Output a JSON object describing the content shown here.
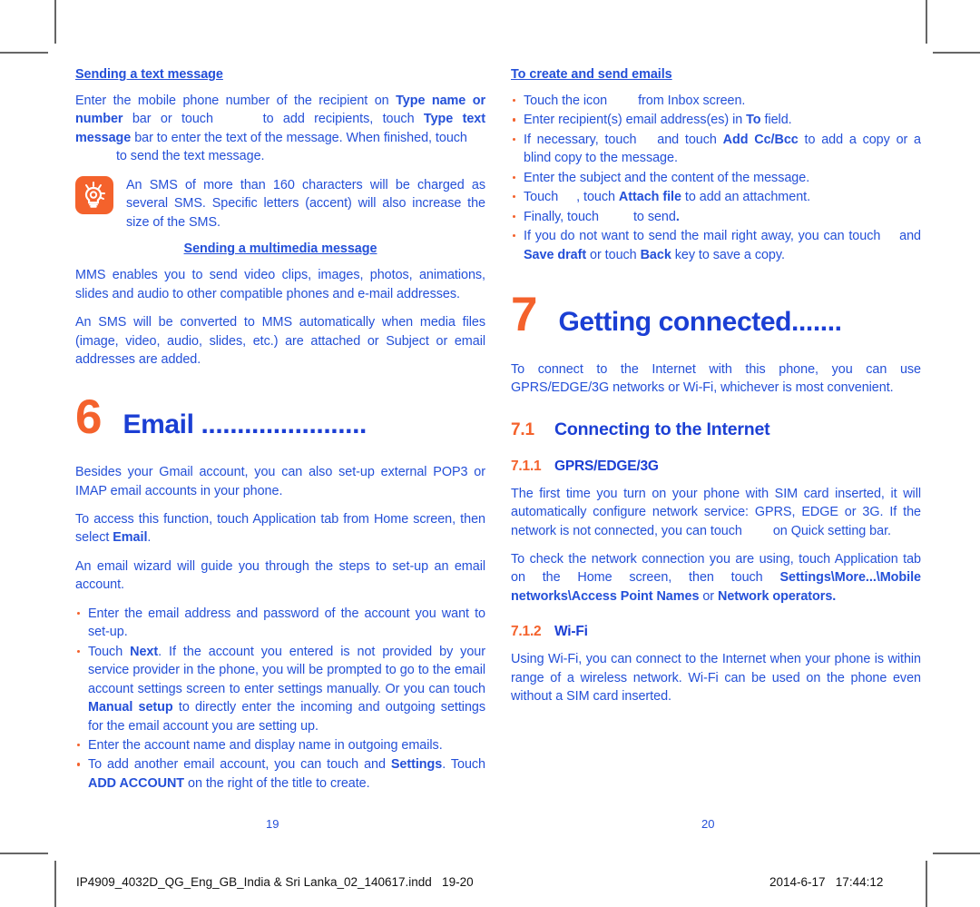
{
  "document": {
    "left_page": {
      "page_number": "19",
      "sections": [
        {
          "heading": "Sending a text message",
          "paragraph_1a": "Enter the mobile phone number of the recipient on ",
          "paragraph_1b": "Type name or number",
          "paragraph_1c": " bar or touch ",
          "paragraph_1d": " to add recipients, touch ",
          "paragraph_1e": "Type text message",
          "paragraph_1f": " bar to enter the text of the message. When finished, touch",
          "paragraph_1g": " to send the text message."
        }
      ],
      "tip": {
        "icon": "lightbulb-tip-icon",
        "text": "An SMS of more than 160 characters will be charged as several SMS. Specific letters (accent) will also increase the size of the SMS."
      },
      "mms": {
        "heading": "Sending a multimedia message",
        "paragraph_1": "MMS enables you to send video clips, images, photos, animations, slides and audio to other compatible phones and e-mail addresses.",
        "paragraph_2": "An SMS will be converted to MMS automatically when media files (image, video, audio, slides, etc.) are attached or Subject or email addresses are added."
      },
      "chapter": {
        "number": "6",
        "title": "Email ......................."
      },
      "email_body": {
        "paragraph_1": "Besides your Gmail account, you can also set-up external POP3 or IMAP email accounts in your phone.",
        "paragraph_2a": "To access this function, touch Application tab from Home screen, then select ",
        "paragraph_2b": "Email",
        "paragraph_2c": ".",
        "paragraph_3": "An email wizard will guide you through the steps to set-up an email account."
      },
      "email_bullets": [
        {
          "parts": [
            {
              "text": "Enter the email address and password of the account you want to set-up.",
              "bold": false
            }
          ]
        },
        {
          "parts": [
            {
              "text": "Touch ",
              "bold": false
            },
            {
              "text": "Next",
              "bold": true
            },
            {
              "text": ". If the account you entered is not provided by your service provider in the phone, you will be prompted to go to the email account settings screen to enter settings manually. Or you can touch ",
              "bold": false
            },
            {
              "text": "Manual setup",
              "bold": true
            },
            {
              "text": " to directly enter the incoming and outgoing settings for the email account you are setting up.",
              "bold": false
            }
          ]
        },
        {
          "parts": [
            {
              "text": "Enter the account name and display name in outgoing emails.",
              "bold": false
            }
          ]
        },
        {
          "parts": [
            {
              "text": "To add another email account, you can touch ",
              "bold": false
            },
            {
              "text": "  ",
              "bold": false
            },
            {
              "text": " and ",
              "bold": false
            },
            {
              "text": "Settings",
              "bold": true
            },
            {
              "text": ". Touch ",
              "bold": false
            },
            {
              "text": "ADD ACCOUNT",
              "bold": true
            },
            {
              "text": " on the right of the title to create.",
              "bold": false
            }
          ]
        }
      ]
    },
    "right_page": {
      "page_number": "20",
      "emails_heading": "To create and send emails",
      "email_bullets": [
        {
          "parts": [
            {
              "text": "Touch the icon",
              "bold": false
            },
            {
              "text": "ICONGAP",
              "bold": false
            },
            {
              "text": "from Inbox screen.",
              "bold": false
            }
          ]
        },
        {
          "parts": [
            {
              "text": "Enter recipient(s) email address(es) in ",
              "bold": false
            },
            {
              "text": "To",
              "bold": true
            },
            {
              "text": " field.",
              "bold": false
            }
          ]
        },
        {
          "parts": [
            {
              "text": "If necessary, touch ",
              "bold": false
            },
            {
              "text": "ICONGAPSM",
              "bold": false
            },
            {
              "text": "and touch ",
              "bold": false
            },
            {
              "text": "Add Cc/Bcc",
              "bold": true
            },
            {
              "text": " to add a copy or a blind copy to the message.",
              "bold": false
            }
          ]
        },
        {
          "parts": [
            {
              "text": "Enter the subject and the content of the message.",
              "bold": false
            }
          ]
        },
        {
          "parts": [
            {
              "text": "Touch ",
              "bold": false
            },
            {
              "text": "ICONGAPSM",
              "bold": false
            },
            {
              "text": ", touch ",
              "bold": false
            },
            {
              "text": "Attach file",
              "bold": true
            },
            {
              "text": " to add an attachment.",
              "bold": false
            }
          ]
        },
        {
          "parts": [
            {
              "text": "Finally, touch ",
              "bold": false
            },
            {
              "text": "ICONGAP",
              "bold": false
            },
            {
              "text": "to send",
              "bold": false
            },
            {
              "text": ".",
              "bold": true
            }
          ]
        },
        {
          "parts": [
            {
              "text": "If you do not want to send the mail right away, you can touch ",
              "bold": false
            },
            {
              "text": "ICONGAPSM",
              "bold": false
            },
            {
              "text": "and ",
              "bold": false
            },
            {
              "text": "Save draft",
              "bold": true
            },
            {
              "text": " or touch ",
              "bold": false
            },
            {
              "text": "Back",
              "bold": true
            },
            {
              "text": " key to save a copy.",
              "bold": false
            }
          ]
        }
      ],
      "chapter": {
        "number": "7",
        "title": "Getting connected......."
      },
      "intro": "To connect to the Internet with this phone, you can use GPRS/EDGE/3G networks or Wi-Fi, whichever is most convenient.",
      "section_71": {
        "number": "7.1",
        "title": "Connecting to the Internet"
      },
      "section_711": {
        "number": "7.1.1",
        "title": "GPRS/EDGE/3G",
        "paragraph_1a": "The first time you turn on your phone with SIM card inserted, it will automatically configure network service: GPRS, EDGE or 3G. If the network is not connected, you can touch",
        "paragraph_1b": "on Quick setting bar.",
        "paragraph_2a": "To check the network connection you are using, touch Application tab on the Home screen, then touch ",
        "paragraph_2b": "Settings\\More...\\Mobile networks\\Access Point Names",
        "paragraph_2c": " or ",
        "paragraph_2d": "Network operators.",
        "paragraph_2e": ""
      },
      "section_712": {
        "number": "7.1.2",
        "title": "Wi-Fi",
        "paragraph_1": "Using Wi-Fi, you can connect to the Internet when your phone is within range of a wireless network. Wi-Fi can be used on the phone even without a SIM card inserted."
      }
    },
    "print_footer": {
      "filename": "IP4909_4032D_QG_Eng_GB_India & Sri Lanka_02_140617.indd   19-20",
      "timestamp": "2014-6-17   17:44:12"
    },
    "colors": {
      "body_blue": "#2450D8",
      "heading_blue": "#1B3FD4",
      "accent_orange": "#F4622C",
      "crop_mark": "#666666",
      "footer_black": "#111111"
    }
  }
}
